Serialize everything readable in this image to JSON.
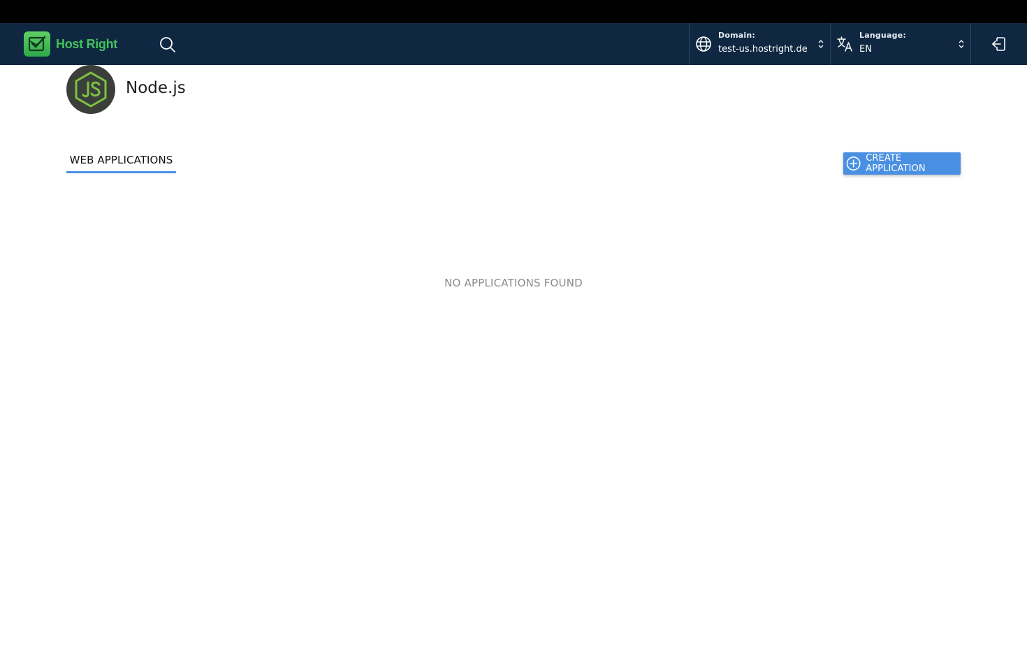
{
  "brand": {
    "name": "Host Right",
    "logo_icon": "checkbox-envelope-icon",
    "color": "#42c25a"
  },
  "navbar": {
    "background": "#0f2741",
    "search_icon": "search-icon",
    "domain": {
      "label": "Domain:",
      "value": "test-us.hostright.de",
      "icon": "globe-icon"
    },
    "language": {
      "label": "Language:",
      "value": "EN",
      "icon": "translate-icon"
    },
    "logout_icon": "logout-icon"
  },
  "app": {
    "title": "Node.js",
    "icon": "nodejs-icon"
  },
  "tabs": [
    {
      "label": "WEB APPLICATIONS",
      "active": true
    }
  ],
  "actions": {
    "create_label": "CREATE APPLICATION",
    "create_icon": "plus-circle-icon",
    "accent": "#4a90e2"
  },
  "empty_state": {
    "message": "NO APPLICATIONS FOUND"
  }
}
